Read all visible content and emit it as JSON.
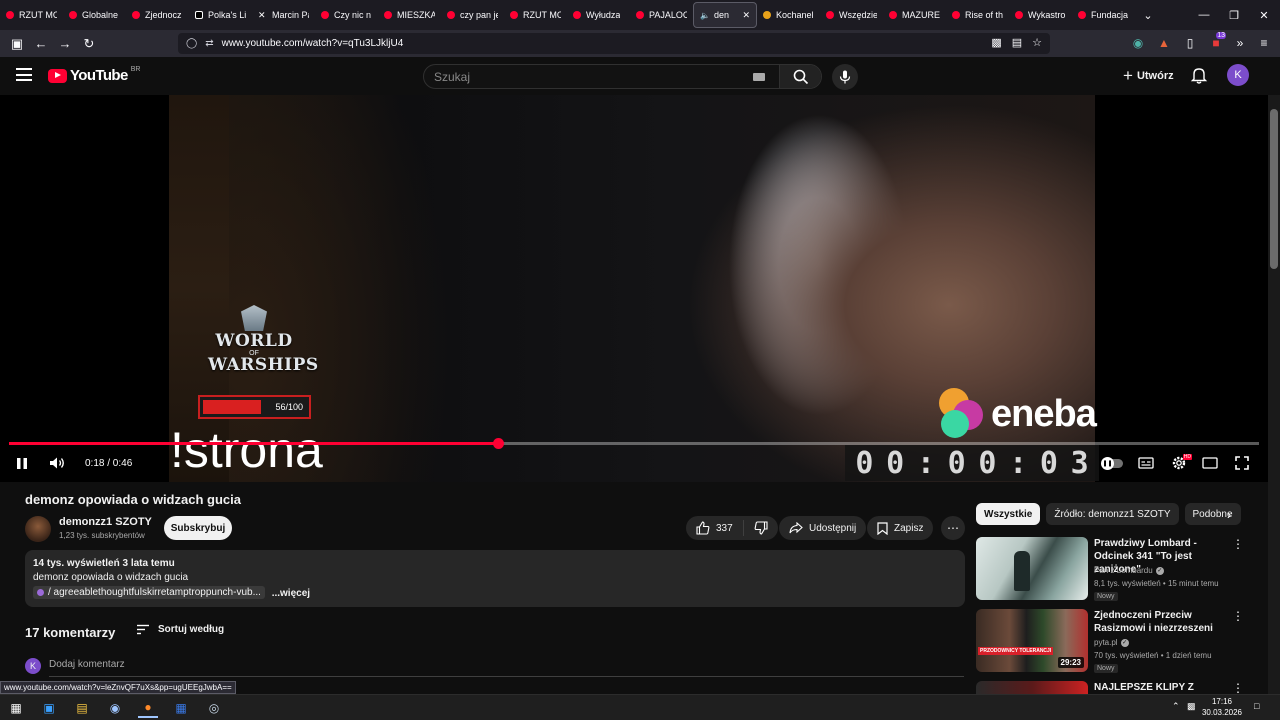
{
  "browser": {
    "tabs": [
      {
        "label": "RZUT MO",
        "favicon": "youtube-icon"
      },
      {
        "label": "Globalne",
        "favicon": "youtube-icon"
      },
      {
        "label": "Zjednocz",
        "favicon": "youtube-icon"
      },
      {
        "label": "Polka's Li",
        "favicon": "tiktok-icon"
      },
      {
        "label": "Marcin Pa",
        "favicon": "x-icon"
      },
      {
        "label": "Czy nic n",
        "favicon": "youtube-icon"
      },
      {
        "label": "MIESZKA",
        "favicon": "youtube-icon"
      },
      {
        "label": "czy pan je",
        "favicon": "youtube-icon"
      },
      {
        "label": "RZUT MO",
        "favicon": "youtube-icon"
      },
      {
        "label": "Wyłudza",
        "favicon": "youtube-icon"
      },
      {
        "label": "PAJALOC",
        "favicon": "youtube-icon"
      },
      {
        "label": "den",
        "favicon": "speaker-icon",
        "active": true
      },
      {
        "label": "Kochanel",
        "favicon": "kochanel-icon"
      },
      {
        "label": "Wszędzie",
        "favicon": "youtube-icon"
      },
      {
        "label": "MAZURE",
        "favicon": "youtube-icon"
      },
      {
        "label": "Rise of th",
        "favicon": "youtube-icon"
      },
      {
        "label": "Wykastro",
        "favicon": "youtube-icon"
      },
      {
        "label": "Fundacja",
        "favicon": "youtube-icon"
      }
    ],
    "url": "www.youtube.com/watch?v=qTu3LJkljU4",
    "status_url": "www.youtube.com/watch?v=leZnvQF7uXs&pp=ugUEEgJwbA==",
    "extension_badge": "13"
  },
  "youtube": {
    "logo_text": "YouTube",
    "country_code": "BR",
    "search_placeholder": "Szukaj",
    "create_label": "Utwórz",
    "avatar_letter": "K"
  },
  "player": {
    "overlay_text": "!strona",
    "wows_line1": "WORLD",
    "wows_of": "OF",
    "wows_line2": "WARSHIPS",
    "hp_text": "56/100",
    "hp_fraction": 0.56,
    "eneba_text": "eneba",
    "timer_digits": [
      "0",
      "0",
      ":",
      "0",
      "0",
      ":",
      "0",
      "3"
    ],
    "time_display": "0:18 / 0:46",
    "progress_fraction": 0.391
  },
  "video": {
    "title": "demonz opowiada o widzach gucia",
    "channel_name": "demonzz1 SZOTY",
    "subscribers": "1,23 tys. subskrybentów",
    "subscribe_label": "Subskrybuj",
    "likes": "337",
    "share_label": "Udostępnij",
    "save_label": "Zapisz",
    "description_meta": "14 tys. wyświetleń  3 lata temu",
    "description_text": "demonz opowiada o widzach gucia",
    "description_link": "/ agreeablethoughtfulskirretamptroppunch-vub...",
    "more_label": "...więcej",
    "comments_count": "17 komentarzy",
    "sort_label": "Sortuj według",
    "comment_avatar": "K",
    "comment_placeholder": "Dodaj komentarz"
  },
  "sidebar": {
    "chips": [
      "Wszystkie",
      "Źródło: demonzz1 SZOTY",
      "Podobne"
    ],
    "recommendations": [
      {
        "title": "Prawdziwy Lombard - Odcinek 341 \"To jest zaniżone\"",
        "channel": "Pan z Lombardu",
        "verified": true,
        "stats": "8,1 tys. wyświetleń • 15 minut temu",
        "badge": "Nowy",
        "duration": ""
      },
      {
        "title": "Zjednoczeni Przeciw Rasizmowi i niezrzeszeni",
        "channel": "pyta.pl",
        "verified": true,
        "stats": "70 tys. wyświetleń • 1 dzień temu",
        "badge": "Nowy",
        "duration": "29:23"
      },
      {
        "title": "NAJLEPSZE KLIPY Z",
        "channel": "",
        "verified": false,
        "stats": "",
        "badge": "",
        "duration": ""
      }
    ]
  },
  "taskbar": {
    "time": "17:16",
    "date": "30.03.2026"
  }
}
